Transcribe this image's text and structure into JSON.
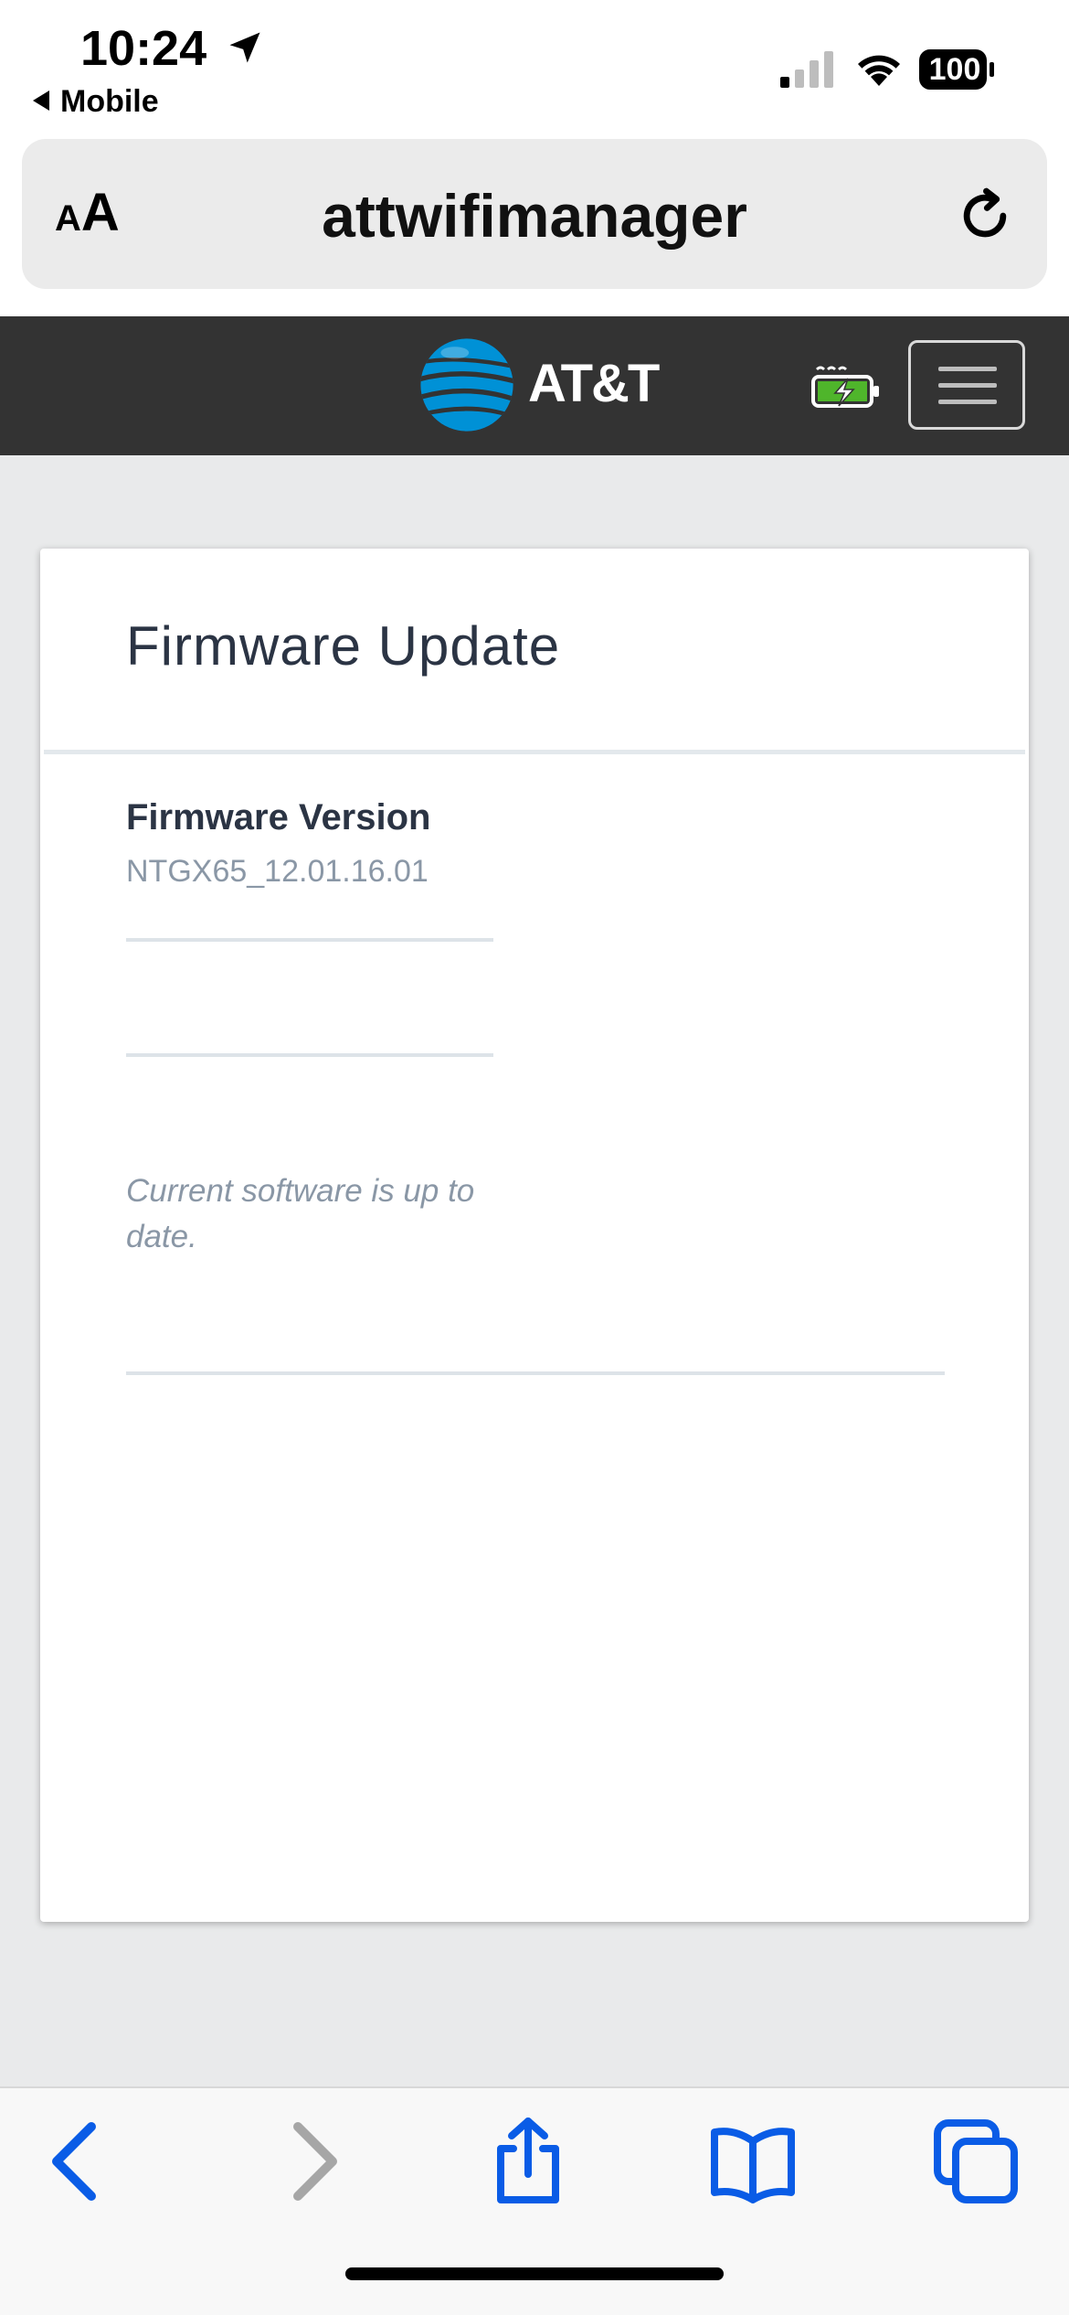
{
  "status_bar": {
    "time": "10:24",
    "back_app": "Mobile",
    "battery": "100",
    "icons": [
      "location-arrow-icon",
      "cellular-signal-icon",
      "wifi-icon",
      "battery-icon"
    ]
  },
  "address_bar": {
    "text_size_label_small": "A",
    "text_size_label_large": "A",
    "url": "attwifimanager",
    "reload_icon": "reload-icon"
  },
  "header": {
    "brand": "AT&T",
    "logo_color": "#0091d6",
    "icons": [
      "att-globe-icon",
      "router-battery-charging-icon",
      "hamburger-menu-icon"
    ]
  },
  "card": {
    "title": "Firmware Update",
    "firmware_label": "Firmware Version",
    "firmware_value": "NTGX65_12.01.16.01",
    "status_message": "Current software is up to date."
  },
  "toolbar": {
    "icons": [
      "back-chevron-icon",
      "forward-chevron-icon",
      "share-icon",
      "bookmarks-icon",
      "tabs-icon"
    ],
    "accent_color": "#0a5ce6"
  }
}
